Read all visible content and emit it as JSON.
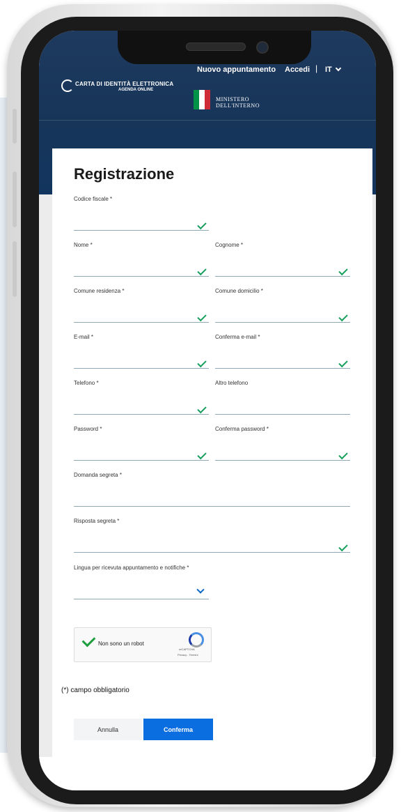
{
  "header": {
    "nav": {
      "appointment": "Nuovo appuntamento",
      "login": "Accedi",
      "separator": "|",
      "language": "IT"
    },
    "logo": {
      "title": "CARTA DI IDENTITÀ ELETTRONICA",
      "subtitle": "AGENDA ONLINE"
    },
    "ministry": {
      "line1": "MINISTERO",
      "line2": "DELL'INTERNO"
    },
    "colors": {
      "background": "#173559",
      "flag_green": "#009246",
      "flag_white": "#ffffff",
      "flag_red": "#ce2b37"
    }
  },
  "form": {
    "title": "Registrazione",
    "fields": {
      "codice_fiscale": "Codice fiscale *",
      "nome": "Nome *",
      "cognome": "Cognome *",
      "comune_residenza": "Comune residenza *",
      "comune_domicilio": "Comune domicilio *",
      "email": "E-mail *",
      "conferma_email": "Conferma e-mail *",
      "telefono": "Telefono *",
      "altro_telefono": "Altro telefono",
      "password": "Password *",
      "conferma_password": "Conferma password *",
      "domanda_segreta": "Domanda segreta *",
      "risposta_segreta": "Risposta segreta *",
      "lingua": "Lingua per ricevuta appuntamento e notifiche *"
    },
    "captcha": {
      "label": "Non sono un robot",
      "brand": "reCAPTCHA",
      "terms": "Privacy - Termini"
    },
    "required_note": "(*) campo obbligatorio",
    "buttons": {
      "cancel": "Annulla",
      "confirm": "Conferma"
    },
    "colors": {
      "check": "#17a05d",
      "primary_button": "#0a6ee0"
    }
  }
}
